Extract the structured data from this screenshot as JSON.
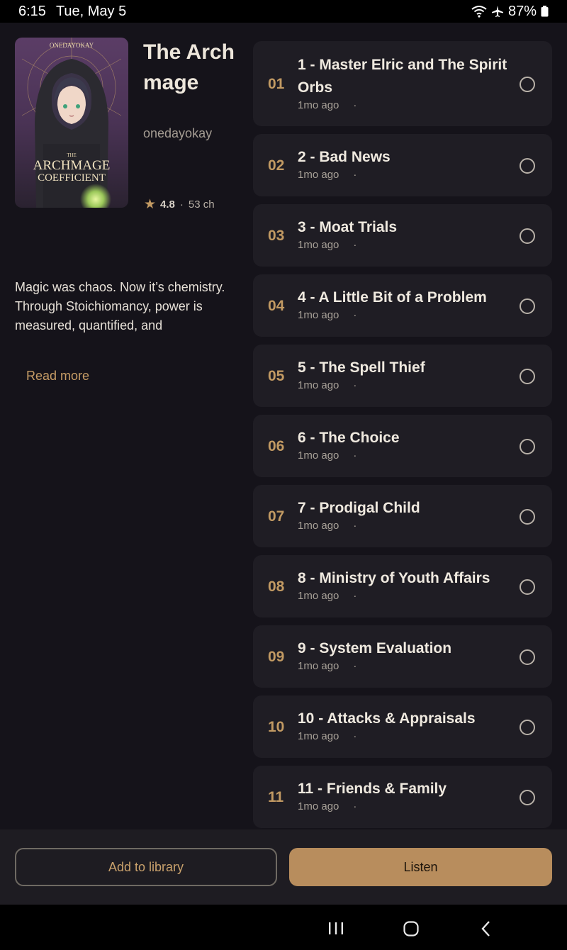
{
  "status_bar": {
    "time": "6:15",
    "date": "Tue, May 5",
    "battery": "87%"
  },
  "book": {
    "title": "The Archmage",
    "author": "onedayokay",
    "rating": "4.8",
    "chapter_count": "53 ch",
    "cover_top_text": "ONEDAYOKAY",
    "cover_title_line1": "THE",
    "cover_title_line2": "ARCHMAGE",
    "cover_title_line3": "COEFFICIENT",
    "synopsis_line1": "Magic was chaos. Now it’s chemistry.",
    "synopsis_line2": "Through Stoichiomancy, power is measured, quantified, and",
    "read_more": "Read more"
  },
  "chapters": [
    {
      "num": "01",
      "title": "1 - Master Elric and The Spirit Orbs",
      "meta": "1mo ago"
    },
    {
      "num": "02",
      "title": "2 - Bad News",
      "meta": "1mo ago"
    },
    {
      "num": "03",
      "title": "3 - Moat Trials",
      "meta": "1mo ago"
    },
    {
      "num": "04",
      "title": "4 - A Little Bit of a Problem",
      "meta": "1mo ago"
    },
    {
      "num": "05",
      "title": "5 - The Spell Thief",
      "meta": "1mo ago"
    },
    {
      "num": "06",
      "title": "6 - The Choice",
      "meta": "1mo ago"
    },
    {
      "num": "07",
      "title": "7 - Prodigal Child",
      "meta": "1mo ago"
    },
    {
      "num": "08",
      "title": "8 - Ministry of Youth Affairs",
      "meta": "1mo ago"
    },
    {
      "num": "09",
      "title": "9 - System Evaluation",
      "meta": "1mo ago"
    },
    {
      "num": "10",
      "title": "10 - Attacks & Appraisals",
      "meta": "1mo ago"
    },
    {
      "num": "11",
      "title": "11 - Friends & Family",
      "meta": "1mo ago"
    }
  ],
  "actions": {
    "add_to_library": "Add to library",
    "listen": "Listen"
  },
  "icons": {
    "wifi": "wifi-icon",
    "airplane": "airplane-icon",
    "battery": "battery-icon",
    "star": "star-icon",
    "radio": "radio-unchecked-icon",
    "nav_recent": "recent-apps-icon",
    "nav_home": "home-icon",
    "nav_back": "back-icon"
  },
  "colors": {
    "accent": "#c29a63",
    "background": "#15131a",
    "card": "#1f1d24",
    "listen_button": "#b88d5d"
  }
}
